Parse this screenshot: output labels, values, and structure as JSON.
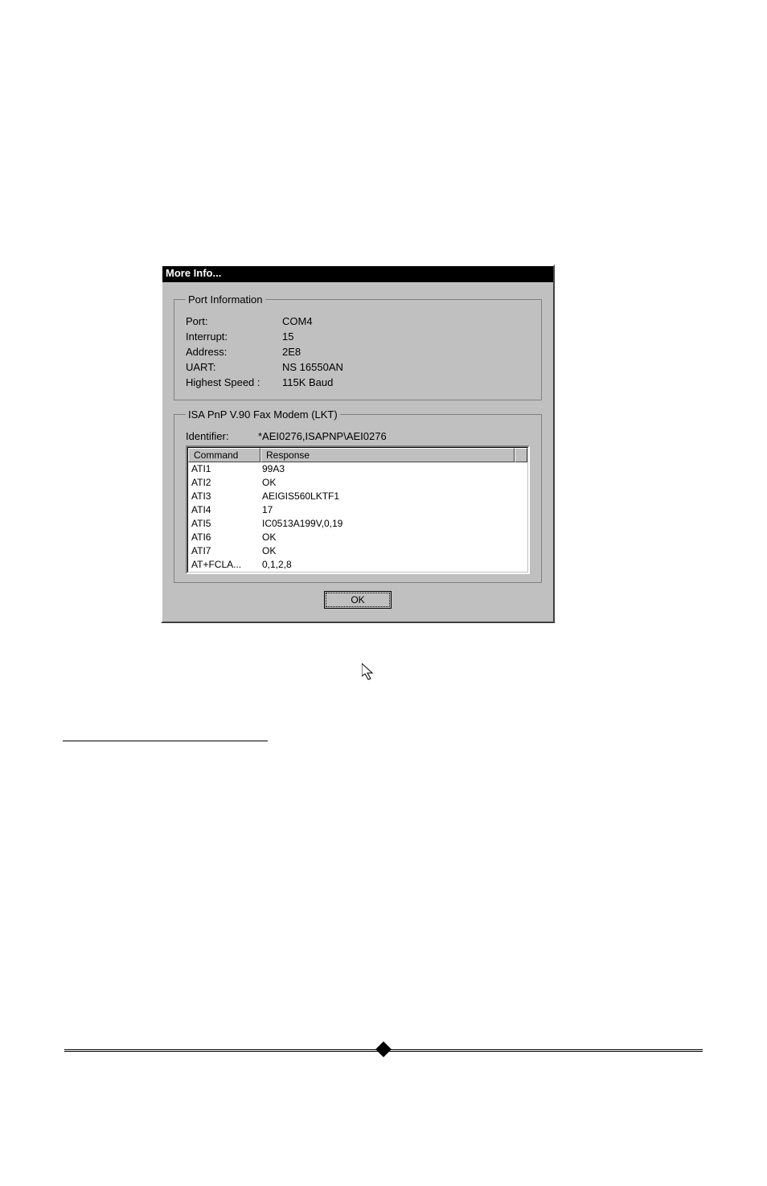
{
  "window": {
    "title": "More Info..."
  },
  "portInfo": {
    "legend": "Port Information",
    "rows": {
      "port_l": "Port:",
      "port_v": "COM4",
      "int_l": "Interrupt:",
      "int_v": "15",
      "addr_l": "Address:",
      "addr_v": "2E8",
      "uart_l": "UART:",
      "uart_v": "NS 16550AN",
      "hs_l": "Highest Speed :",
      "hs_v": "115K Baud"
    }
  },
  "modem": {
    "legend": "ISA PnP V.90 Fax Modem (LKT)",
    "ident_l": "Identifier:",
    "ident_v": "*AEI0276,ISAPNP\\AEI0276",
    "headers": {
      "cmd": "Command",
      "resp": "Response"
    },
    "rows": [
      {
        "cmd": "ATI1",
        "resp": "99A3"
      },
      {
        "cmd": "ATI2",
        "resp": "OK"
      },
      {
        "cmd": "ATI3",
        "resp": "AEIGIS560LKTF1"
      },
      {
        "cmd": "ATI4",
        "resp": "17"
      },
      {
        "cmd": "ATI5",
        "resp": "IC0513A199V,0,19"
      },
      {
        "cmd": "ATI6",
        "resp": "OK"
      },
      {
        "cmd": "ATI7",
        "resp": "OK"
      },
      {
        "cmd": "AT+FCLA...",
        "resp": "0,1,2,8"
      }
    ]
  },
  "buttons": {
    "ok": "OK"
  }
}
